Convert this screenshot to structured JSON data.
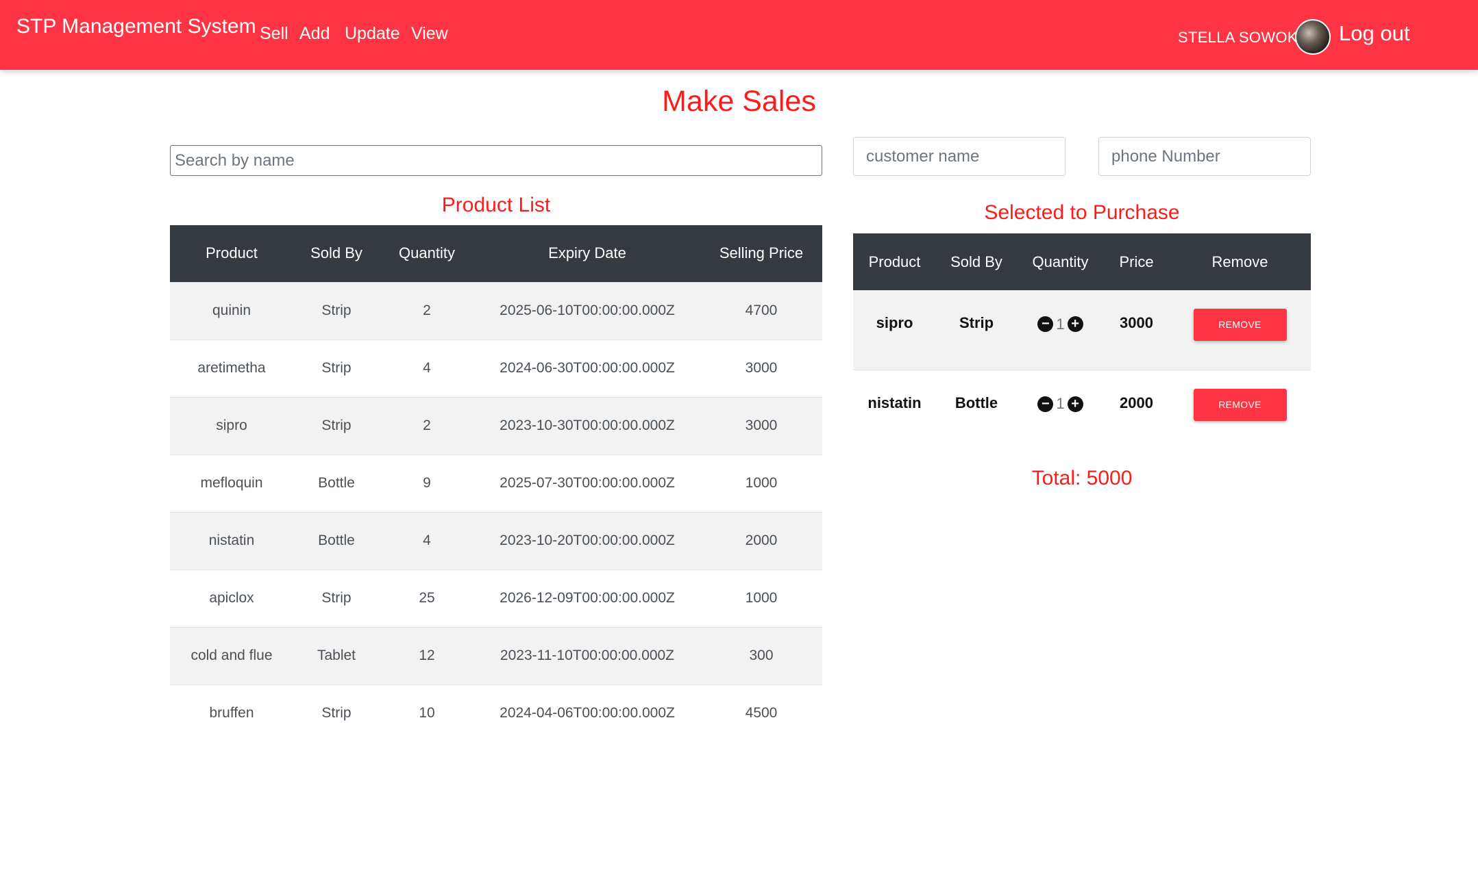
{
  "nav": {
    "brand": "STP Management System",
    "links": [
      "Sell",
      "Add",
      "Update",
      "View"
    ],
    "user_name": "STELLA SOWOKI",
    "logout": "Log out"
  },
  "page_title": "Make Sales",
  "search": {
    "placeholder": "Search by name",
    "value": ""
  },
  "customer": {
    "name_placeholder": "customer name",
    "phone_placeholder": "phone Number"
  },
  "product_list": {
    "title": "Product List",
    "headers": [
      "Product",
      "Sold By",
      "Quantity",
      "Expiry Date",
      "Selling Price"
    ],
    "rows": [
      [
        "quinin",
        "Strip",
        "2",
        "2025-06-10T00:00:00.000Z",
        "4700"
      ],
      [
        "aretimetha",
        "Strip",
        "4",
        "2024-06-30T00:00:00.000Z",
        "3000"
      ],
      [
        "sipro",
        "Strip",
        "2",
        "2023-10-30T00:00:00.000Z",
        "3000"
      ],
      [
        "mefloquin",
        "Bottle",
        "9",
        "2025-07-30T00:00:00.000Z",
        "1000"
      ],
      [
        "nistatin",
        "Bottle",
        "4",
        "2023-10-20T00:00:00.000Z",
        "2000"
      ],
      [
        "apiclox",
        "Strip",
        "25",
        "2026-12-09T00:00:00.000Z",
        "1000"
      ],
      [
        "cold and flue",
        "Tablet",
        "12",
        "2023-11-10T00:00:00.000Z",
        "300"
      ],
      [
        "bruffen",
        "Strip",
        "10",
        "2024-04-06T00:00:00.000Z",
        "4500"
      ]
    ]
  },
  "cart": {
    "title": "Selected to Purchase",
    "headers": [
      "Product",
      "Sold By",
      "Quantity",
      "Price",
      "Remove"
    ],
    "remove_label": "REMOVE",
    "rows": [
      {
        "product": "sipro",
        "sold_by": "Strip",
        "quantity": "1",
        "price": "3000"
      },
      {
        "product": "nistatin",
        "sold_by": "Bottle",
        "quantity": "1",
        "price": "2000"
      }
    ],
    "total": "Total: 5000"
  },
  "colors": {
    "navbar": "#fe3444",
    "accent_text": "#fe1b1b",
    "table_header": "#343a40",
    "stripe": "#f2f2f2"
  }
}
